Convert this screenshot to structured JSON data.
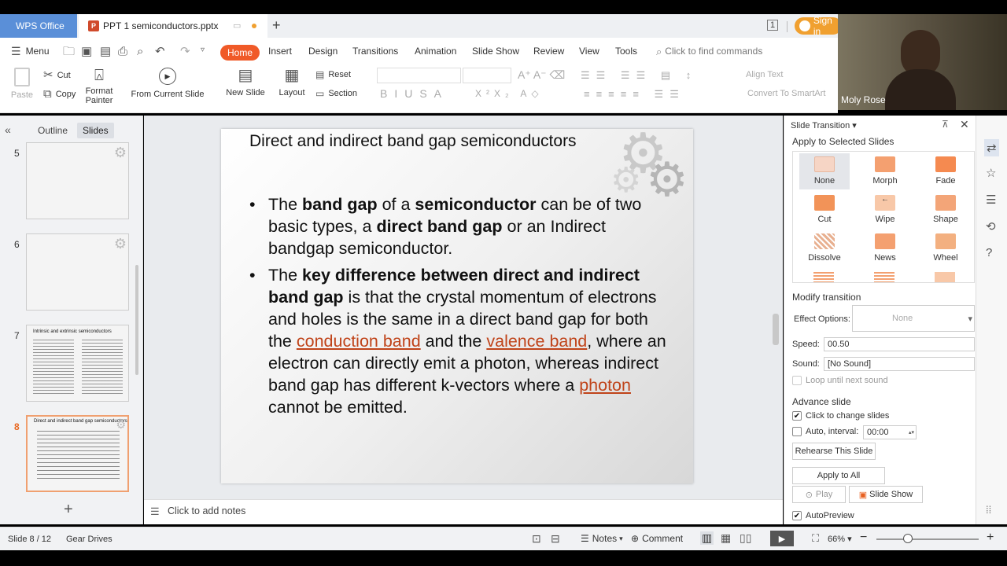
{
  "tabs": {
    "app": "WPS Office",
    "document": "PPT 1 semiconductors.pptx",
    "sign_in": "Sign in"
  },
  "menu": {
    "menu_label": "Menu",
    "items": [
      "Home",
      "Insert",
      "Design",
      "Transitions",
      "Animation",
      "Slide Show",
      "Review",
      "View",
      "Tools"
    ],
    "find_placeholder": "Click to find commands"
  },
  "ribbon": {
    "paste": "Paste",
    "cut": "Cut",
    "copy": "Copy",
    "format_painter_1": "Format",
    "format_painter_2": "Painter",
    "from_current": "From Current Slide",
    "new_slide": "New Slide",
    "layout": "Layout",
    "reset": "Reset",
    "section": "Section",
    "align_text": "Align Text",
    "smartart": "Convert To SmartArt"
  },
  "webcam": {
    "name": "Moly Rose"
  },
  "left_panel": {
    "outline": "Outline",
    "slides": "Slides",
    "thumbs": [
      {
        "num": "5"
      },
      {
        "num": "6"
      },
      {
        "num": "7",
        "title": "Intrinsic and extrinsic semiconductors"
      },
      {
        "num": "8",
        "title": "Direct and indirect band gap semiconductors"
      }
    ]
  },
  "slide": {
    "title": "Direct and indirect band gap semiconductors",
    "b1": {
      "t1": "The ",
      "t2": "band gap",
      "t3": " of a ",
      "t4": "semiconductor",
      "t5": " can be of two basic types, a ",
      "t6": "direct band gap",
      "t7": " or an Indirect bandgap semiconductor."
    },
    "b2": {
      "t1": "The ",
      "t2": "key difference between direct and indirect band gap",
      "t3": " is that the crystal momentum of electrons and holes is the same in a direct band gap for both the ",
      "link1": "conduction band",
      "t4": " and the ",
      "link2": "valence band",
      "t5": ", where an electron can directly emit a photon, whereas indirect band gap has different k-vectors where a ",
      "link3": "photon",
      "t6": " cannot be emitted."
    }
  },
  "notes": {
    "placeholder": "Click to add notes"
  },
  "right_panel": {
    "title": "Slide Transition",
    "apply_selected": "Apply to Selected Slides",
    "transitions": [
      {
        "label": "None",
        "color": "#f6d5c5"
      },
      {
        "label": "Morph",
        "color": "#f4a070"
      },
      {
        "label": "Fade",
        "color": "#f58a50"
      },
      {
        "label": "Cut",
        "color": "#f29358"
      },
      {
        "label": "Wipe",
        "color": "#f8c8a8"
      },
      {
        "label": "Shape",
        "color": "#f3a578"
      },
      {
        "label": "Dissolve",
        "color": "#e8b090"
      },
      {
        "label": "News",
        "color": "#f4a070"
      },
      {
        "label": "Wheel",
        "color": "#f3b080"
      }
    ],
    "modify": "Modify transition",
    "effect_options": "Effect Options:",
    "effect_value": "None",
    "speed_label": "Speed:",
    "speed_value": "00.50",
    "sound_label": "Sound:",
    "sound_value": "[No Sound]",
    "loop": "Loop until next sound",
    "advance": "Advance slide",
    "click_change": "Click to change slides",
    "auto_interval": "Auto, interval:",
    "interval_value": "00:00",
    "rehearse": "Rehearse This Slide",
    "apply_all": "Apply to All",
    "play": "Play",
    "slide_show": "Slide Show",
    "autopreview": "AutoPreview"
  },
  "status": {
    "slide_count": "Slide 8 / 12",
    "theme": "Gear Drives",
    "notes": "Notes",
    "comment": "Comment",
    "zoom": "66%"
  },
  "colors": {
    "accent": "#f05a28",
    "wps_blue": "#5a8fd8",
    "link": "#c0441a"
  }
}
